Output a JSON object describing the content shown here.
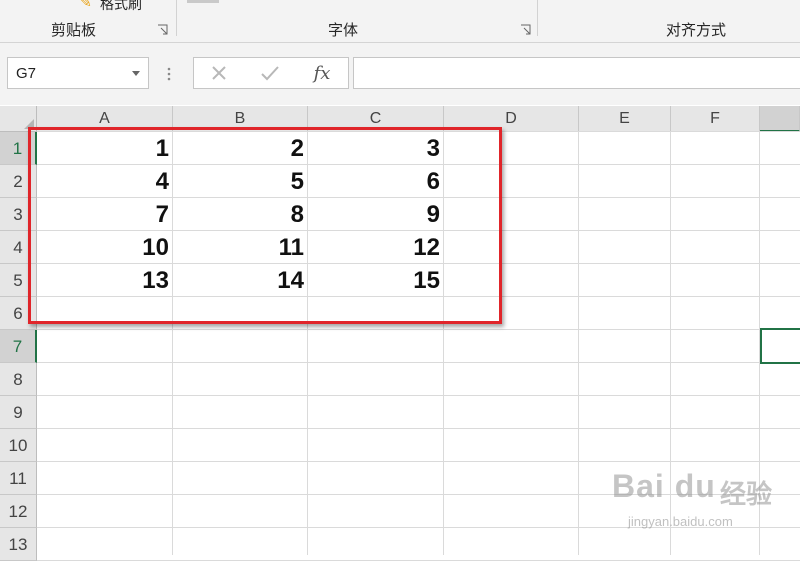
{
  "ribbon": {
    "partial_label": "格式刷",
    "groups": [
      {
        "label": "剪贴板"
      },
      {
        "label": "字体"
      },
      {
        "label": "对齐方式"
      }
    ]
  },
  "formula_bar": {
    "name_box": "G7",
    "fx_label": "fx",
    "formula": ""
  },
  "columns": [
    "A",
    "B",
    "C",
    "D",
    "E",
    "F"
  ],
  "rows": [
    "1",
    "2",
    "3",
    "4",
    "5",
    "6",
    "7",
    "8",
    "9",
    "10",
    "11",
    "12",
    "13"
  ],
  "cells": [
    [
      "1",
      "2",
      "3"
    ],
    [
      "4",
      "5",
      "6"
    ],
    [
      "7",
      "8",
      "9"
    ],
    [
      "10",
      "11",
      "12"
    ],
    [
      "13",
      "14",
      "15"
    ]
  ],
  "active_cell": "G7",
  "highlight_color": "#e0252a",
  "accent_color": "#217346",
  "watermark": {
    "logo": "Bai du",
    "text": "经验",
    "url": "jingyan.baidu.com"
  }
}
